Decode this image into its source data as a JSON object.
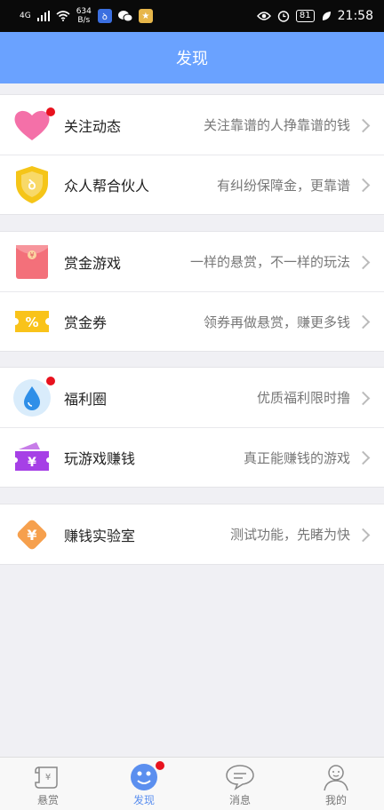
{
  "status_bar": {
    "network": "4G",
    "speed_value": "634",
    "speed_unit": "B/s",
    "battery": "81",
    "time": "21:58",
    "icons": [
      "signal-icon",
      "wifi-icon",
      "app-icon",
      "wechat-icon",
      "star-app-icon",
      "eye-icon",
      "alarm-icon",
      "battery-icon",
      "leaf-icon"
    ]
  },
  "header": {
    "title": "发现"
  },
  "groups": [
    {
      "items": [
        {
          "title": "关注动态",
          "desc": "关注靠谱的人挣靠谱的钱",
          "icon": "heart-icon",
          "badge": true
        },
        {
          "title": "众人帮合伙人",
          "desc": "有纠纷保障金，更靠谱",
          "icon": "shield-icon",
          "badge": false
        }
      ]
    },
    {
      "items": [
        {
          "title": "赏金游戏",
          "desc": "一样的悬赏，不一样的玩法",
          "icon": "red-envelope-icon",
          "badge": false
        },
        {
          "title": "赏金券",
          "desc": "领券再做悬赏，赚更多钱",
          "icon": "coupon-icon",
          "badge": false
        }
      ]
    },
    {
      "items": [
        {
          "title": "福利圈",
          "desc": "优质福利限时撸",
          "icon": "water-drop-icon",
          "badge": true
        },
        {
          "title": "玩游戏赚钱",
          "desc": "真正能赚钱的游戏",
          "icon": "ticket-icon",
          "badge": false
        }
      ]
    },
    {
      "items": [
        {
          "title": "赚钱实验室",
          "desc": "测试功能，先睹为快",
          "icon": "yuan-diamond-icon",
          "badge": false
        }
      ]
    }
  ],
  "tabbar": {
    "tabs": [
      {
        "label": "悬赏",
        "icon": "scroll-icon",
        "active": false
      },
      {
        "label": "发现",
        "icon": "compass-icon",
        "active": true,
        "badge": true
      },
      {
        "label": "消息",
        "icon": "chat-bubble-icon",
        "active": false
      },
      {
        "label": "我的",
        "icon": "user-icon",
        "active": false
      }
    ]
  },
  "colors": {
    "header": "#6aa2ff",
    "active_tab": "#5b8fef",
    "badge": "#e8121e",
    "heart": "#f470a8",
    "shield": "#f5c518",
    "envelope": "#f3707a",
    "coupon": "#f9c31a",
    "drop": "#2f8fe8",
    "ticket": "#a640e6",
    "diamond": "#f6a04d"
  }
}
